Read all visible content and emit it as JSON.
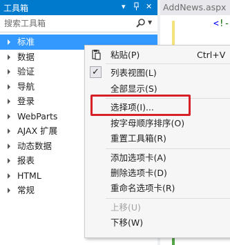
{
  "toolbox": {
    "title": "工具箱",
    "search_placeholder": "搜索工具箱",
    "items": [
      {
        "label": "标准",
        "selected": true
      },
      {
        "label": "数据"
      },
      {
        "label": "验证"
      },
      {
        "label": "导航"
      },
      {
        "label": "登录"
      },
      {
        "label": "WebParts"
      },
      {
        "label": "AJAX 扩展"
      },
      {
        "label": "动态数据"
      },
      {
        "label": "报表"
      },
      {
        "label": "HTML"
      },
      {
        "label": "常规"
      }
    ]
  },
  "editor": {
    "tab_label": "AddNews.aspx",
    "code_fragment_open": "<",
    "code_fragment_comment": "!-"
  },
  "context_menu": {
    "items": [
      {
        "label": "粘贴(P)",
        "shortcut": "Ctrl+V"
      },
      {
        "label": "列表视图(L)",
        "checked": true
      },
      {
        "label": "全部显示(S)"
      },
      {
        "label": "选择项(I)...",
        "highlighted": true
      },
      {
        "label": "按字母顺序排序(O)"
      },
      {
        "label": "重置工具箱(R)"
      },
      {
        "label": "添加选项卡(A)"
      },
      {
        "label": "删除选项卡(D)"
      },
      {
        "label": "重命名选项卡(R)"
      },
      {
        "label": "上移(U)",
        "disabled": true
      },
      {
        "label": "下移(W)"
      }
    ]
  },
  "colors": {
    "accent": "#007acc",
    "selection": "#3399ff",
    "highlight_frame": "#d61f26"
  }
}
